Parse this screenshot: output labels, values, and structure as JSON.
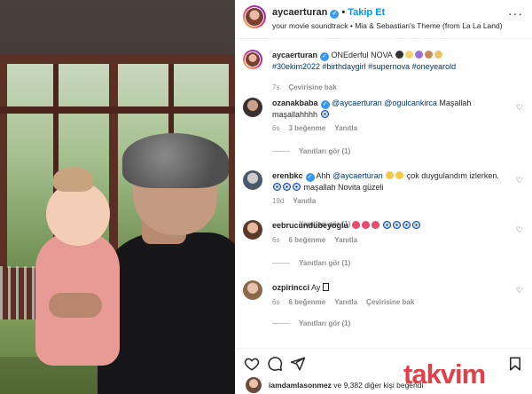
{
  "post": {
    "username": "aycaerturan",
    "follow_label": "Takip Et",
    "audio": "your movie soundtrack • Mia & Sebastian's Theme (from La La Land)"
  },
  "caption": {
    "username": "aycaerturan",
    "text": "ONEderful NOVA",
    "hashtags": "#30ekim2022 #birthdaygirl #supernova #oneyearold",
    "time": "7s",
    "translate": "Çevirisine bak"
  },
  "comments": [
    {
      "username": "ozanakbaba",
      "mention": "@aycaerturan @ogulcankirca",
      "text": "Maşallah maşallahhhh",
      "time": "6s",
      "likes": "3 beğenme",
      "reply": "Yanıtla",
      "replies": "Yanıtları gör (1)"
    },
    {
      "username": "erenbkc",
      "mention": "@aycaerturan",
      "text_a": "Ahh",
      "text_b": "çok duygulandım izlerken.",
      "text_c": "maşallah Novita güzeli",
      "time": "19d",
      "reply": "Yanıtla",
      "replies": "Yanıtları gör (1)"
    },
    {
      "username": "eebrucundubeyoglu",
      "time": "6s",
      "likes": "6 beğenme",
      "reply": "Yanıtla",
      "replies": "Yanıtları gör (1)"
    },
    {
      "username": "ozpirincci",
      "text": "Ay",
      "time": "6s",
      "likes": "6 beğenme",
      "reply": "Yanıtla",
      "translate": "Çevirisine bak",
      "replies": "Yanıtları gör (1)"
    }
  ],
  "likes": {
    "user": "iamdamlasonmez",
    "text": "ve 9,382 diğer kişi beğendi"
  },
  "watermark": "takvim",
  "colors": {
    "accent": "#0095f6",
    "verified": "#3897f0",
    "watermark": "#dc1e28"
  },
  "icons": [
    "more-icon",
    "heart-icon",
    "comment-icon",
    "share-icon",
    "bookmark-icon",
    "verified-icon"
  ]
}
